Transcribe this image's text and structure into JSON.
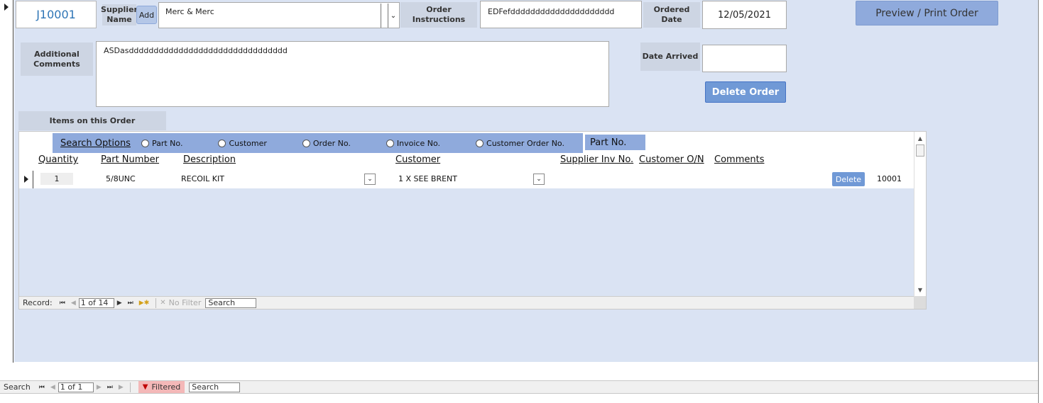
{
  "order": {
    "id": "J10001",
    "supplier_label": "Supplier Name",
    "add_label": "Add",
    "supplier_value": "Merc & Merc",
    "instructions_label": "Order Instructions",
    "instructions_value": "EDFefddddddddddddddddddddd",
    "ordered_date_label": "Ordered Date",
    "ordered_date_value": "12/05/2021",
    "print_label": "Preview / Print Order",
    "comments_label": "Additional Comments",
    "comments_value": "ASDasdddddddddddddddddddddddddddddddd",
    "date_arrived_label": "Date Arrived",
    "date_arrived_value": "",
    "delete_order_label": "Delete Order",
    "items_label": "Items on this Order"
  },
  "subform": {
    "search_options_label": "Search Options",
    "radio_options": [
      "Part No.",
      "Customer",
      "Order No.",
      "Invoice No.",
      "Customer Order No."
    ],
    "search_mode": "Part No.",
    "columns": {
      "quantity": "Quantity",
      "part_number": "Part Number",
      "description": "Description",
      "customer": "Customer",
      "supplier_inv": "Supplier Inv No.",
      "customer_on": "Customer O/N",
      "comments": "Comments"
    },
    "rows": [
      {
        "quantity": "1",
        "part_number": "5/8UNC",
        "description": "RECOIL KIT",
        "customer": "1 X SEE BRENT",
        "delete_label": "Delete",
        "id": "10001"
      }
    ],
    "nav": {
      "record_label": "Record:",
      "counter": "1 of 14",
      "filter_label": "No Filter",
      "search_placeholder": "Search"
    }
  },
  "main_nav": {
    "search_label": "Search",
    "counter": "1 of 1",
    "filtered_label": "Filtered",
    "search_placeholder": "Search"
  },
  "colors": {
    "form_background": "#dae3f3",
    "accent_blue": "#8faadc",
    "button_blue": "#7099d6",
    "id_text": "#2e75b6",
    "filtered_badge": "#f4b8b8"
  }
}
